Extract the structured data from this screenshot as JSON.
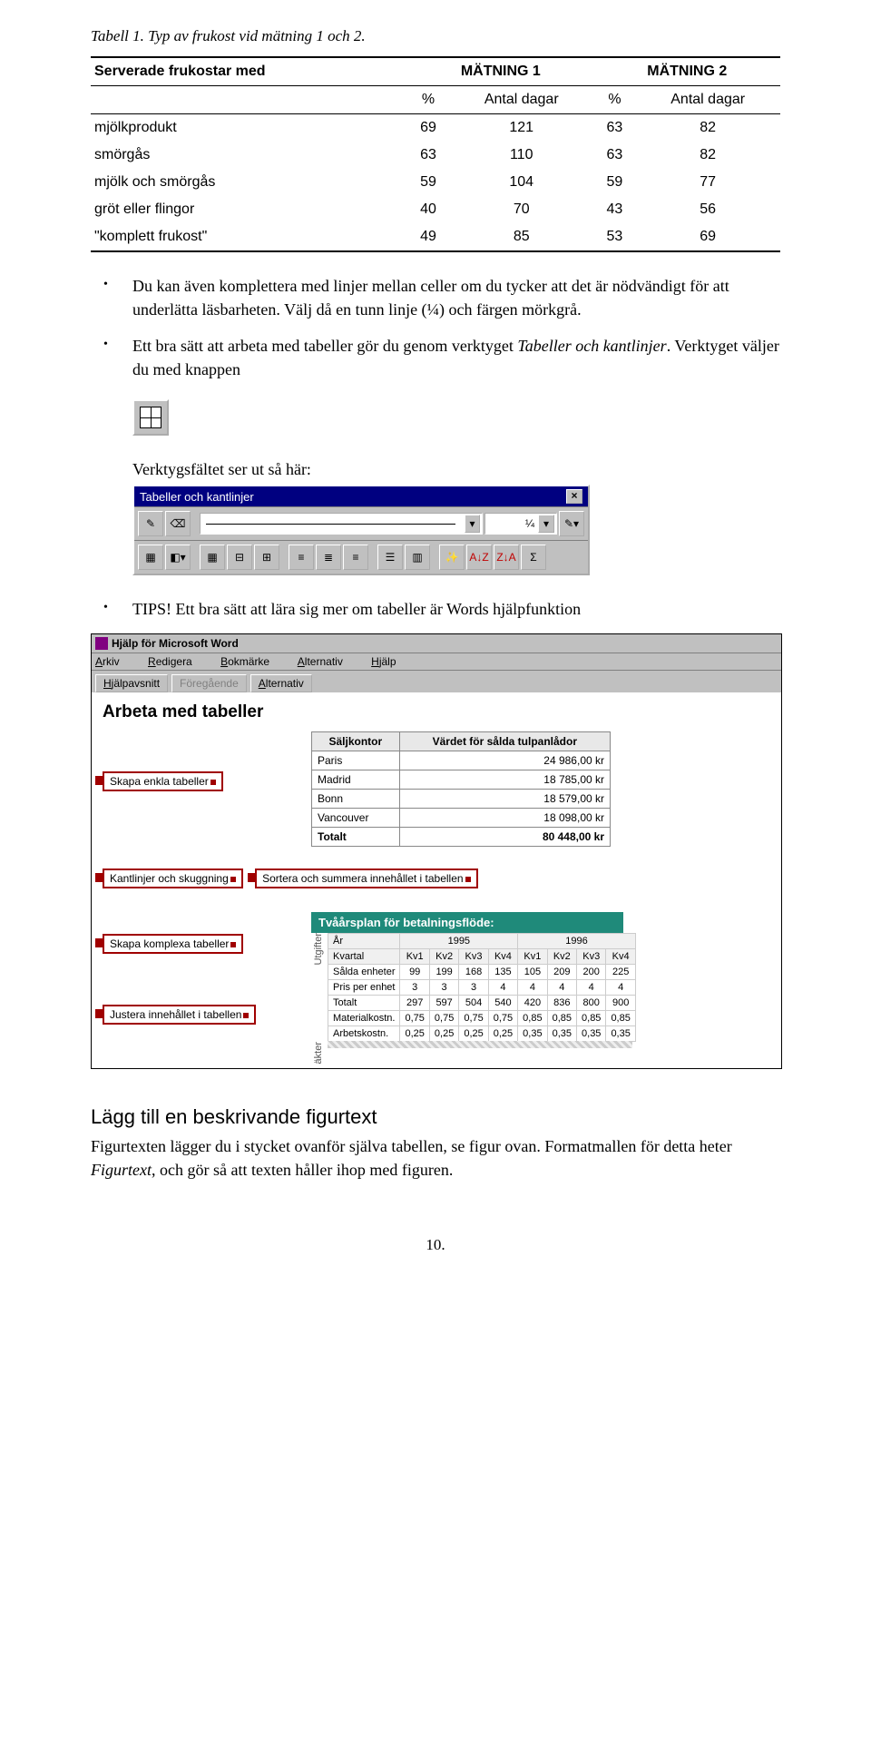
{
  "caption": "Tabell 1. Typ av frukost vid mätning 1 och 2.",
  "tbl1": {
    "h1": "Serverade frukostar med",
    "h2": "MÄTNING 1",
    "h3": "MÄTNING 2",
    "sub_pct": "%",
    "sub_days": "Antal dagar",
    "rows": [
      {
        "l": "mjölkprodukt",
        "a": "69",
        "b": "121",
        "c": "63",
        "d": "82"
      },
      {
        "l": "smörgås",
        "a": "63",
        "b": "110",
        "c": "63",
        "d": "82"
      },
      {
        "l": "mjölk och smörgås",
        "a": "59",
        "b": "104",
        "c": "59",
        "d": "77"
      },
      {
        "l": "gröt eller flingor",
        "a": "40",
        "b": "70",
        "c": "43",
        "d": "56"
      },
      {
        "l": "\"komplett frukost\"",
        "a": "49",
        "b": "85",
        "c": "53",
        "d": "69"
      }
    ]
  },
  "bul1_a": "Du kan även komplettera med linjer mellan celler om du tycker att det är nödvändigt för att underlätta läsbarheten. Välj då en tunn linje (¼)  och färgen mörkgrå.",
  "bul2_a": "Ett bra sätt att arbeta med tabeller gör du genom verktyget ",
  "bul2_i": "Tabeller och kantlinjer",
  "bul2_b": ". Verktyget väljer du med knappen",
  "subhead": "Verktygsfältet ser ut så här:",
  "toolbar": {
    "title": "Tabeller och kantlinjer",
    "close": "×",
    "width": "¼",
    "sigma": "Σ",
    "az": "A↓Z",
    "za": "Z↓A"
  },
  "tips_a": "TIPS! Ett bra sätt att lära sig mer om tabeller är Words hjälpfunktion",
  "help": {
    "title": "Hjälp för Microsoft Word",
    "menu": {
      "arkiv": "Arkiv",
      "red": "Redigera",
      "bok": "Bokmärke",
      "alt": "Alternativ",
      "hj": "Hjälp"
    },
    "tabs": {
      "a": "Hjälpavsnitt",
      "b": "Föregående",
      "c": "Alternativ"
    },
    "h1": "Arbeta med tabeller",
    "buttons": {
      "b1": "Skapa enkla tabeller",
      "b2": "Kantlinjer och skuggning",
      "b3": "Sortera och summera innehållet i tabellen",
      "b4": "Skapa komplexa tabeller",
      "b5": "Justera innehållet i tabellen"
    },
    "tulip": {
      "h1": "Säljkontor",
      "h2": "Värdet för sålda tulpanlådor",
      "rows": [
        {
          "l": "Paris",
          "v": "24 986,00 kr"
        },
        {
          "l": "Madrid",
          "v": "18 785,00 kr"
        },
        {
          "l": "Bonn",
          "v": "18 579,00 kr"
        },
        {
          "l": "Vancouver",
          "v": "18 098,00 kr"
        }
      ],
      "tot_l": "Totalt",
      "tot_v": "80 448,00 kr"
    },
    "teal": "Tvåårsplan för betalningsflöde:",
    "plan": {
      "yr": "År",
      "y1": "1995",
      "y2": "1996",
      "kv": "Kvartal",
      "q": [
        "Kv1",
        "Kv2",
        "Kv3",
        "Kv4",
        "Kv1",
        "Kv2",
        "Kv3",
        "Kv4"
      ],
      "rows": [
        {
          "l": "Sålda enheter",
          "v": [
            "99",
            "199",
            "168",
            "135",
            "105",
            "209",
            "200",
            "225"
          ]
        },
        {
          "l": "Pris per enhet",
          "v": [
            "3",
            "3",
            "3",
            "4",
            "4",
            "4",
            "4",
            "4"
          ]
        },
        {
          "l": "Totalt",
          "v": [
            "297",
            "597",
            "504",
            "540",
            "420",
            "836",
            "800",
            "900"
          ]
        },
        {
          "l": "Materialkostn.",
          "v": [
            "0,75",
            "0,75",
            "0,75",
            "0,75",
            "0,85",
            "0,85",
            "0,85",
            "0,85"
          ]
        },
        {
          "l": "Arbetskostn.",
          "v": [
            "0,25",
            "0,25",
            "0,25",
            "0,25",
            "0,35",
            "0,35",
            "0,35",
            "0,35"
          ]
        }
      ],
      "side1": "Utgifter",
      "side2": "äkter"
    }
  },
  "section": {
    "h": "Lägg till en beskrivande figurtext",
    "p_a": "Figurtexten lägger du i stycket ovanför själva tabellen, se figur ovan. Formatmallen för detta heter ",
    "p_i": "Figurtext",
    "p_b": ", och gör så att texten håller ihop med figuren."
  },
  "pagenum": "10."
}
